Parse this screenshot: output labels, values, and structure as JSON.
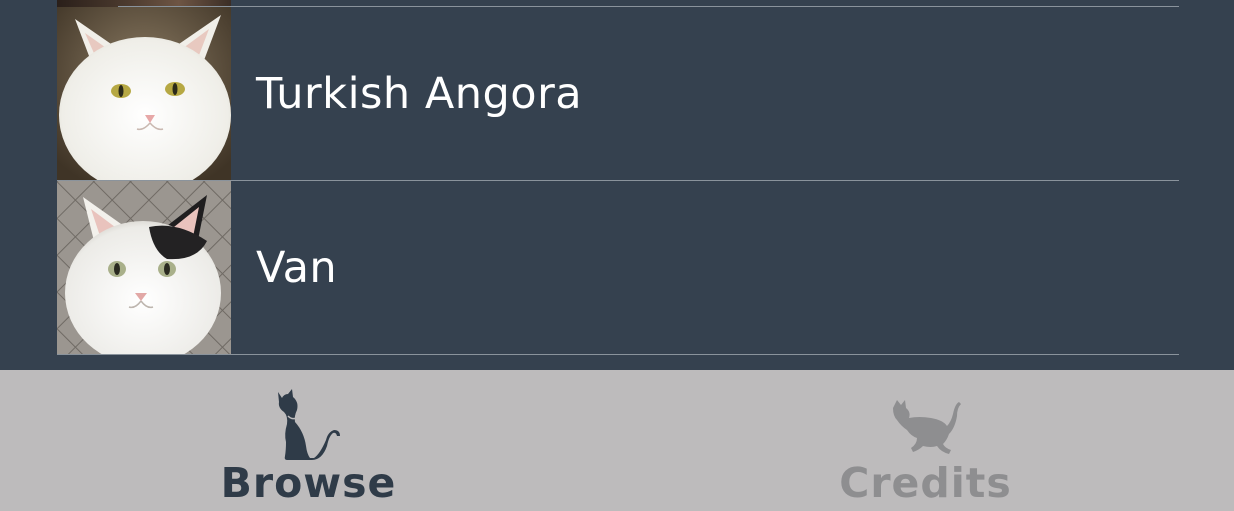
{
  "list": {
    "items": [
      {
        "label": "Turkish Angora",
        "thumbnail": "white-cat-photo"
      },
      {
        "label": "Van",
        "thumbnail": "white-black-cat-photo"
      }
    ]
  },
  "tabbar": {
    "tabs": [
      {
        "label": "Browse",
        "icon": "sitting-cat-icon",
        "active": true
      },
      {
        "label": "Credits",
        "icon": "running-cat-icon",
        "active": false
      }
    ]
  },
  "colors": {
    "background": "#35414f",
    "divider": "#8a939c",
    "tabbar": "#bdbbbc",
    "tab_active": "#2f3b48",
    "tab_inactive": "#8e8e90",
    "row_text": "#ffffff"
  }
}
